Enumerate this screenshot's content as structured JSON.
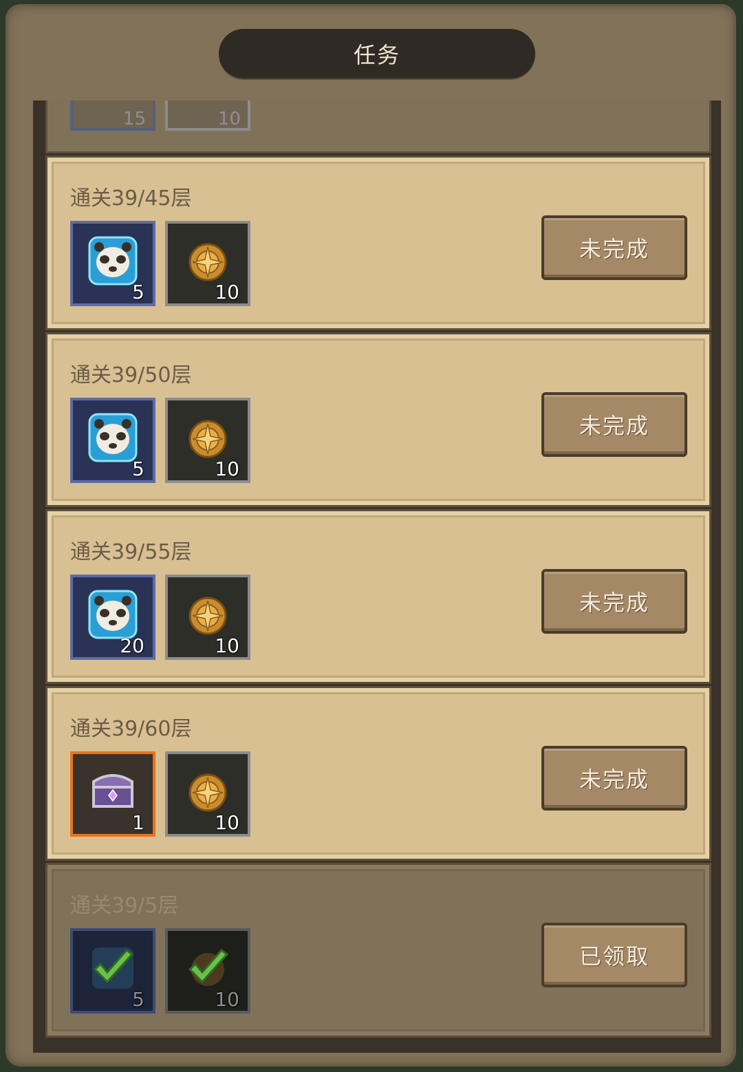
{
  "title": "任务",
  "partial_row": {
    "counts": [
      "15",
      "10"
    ]
  },
  "quests": [
    {
      "label": "通关39/45层",
      "status": "未完成",
      "rewards": [
        {
          "icon": "panda-head-icon",
          "frame": "blue",
          "count": "5"
        },
        {
          "icon": "gold-medal-icon",
          "frame": "gray",
          "count": "10"
        }
      ]
    },
    {
      "label": "通关39/50层",
      "status": "未完成",
      "rewards": [
        {
          "icon": "panda-head-icon",
          "frame": "blue",
          "count": "5"
        },
        {
          "icon": "gold-medal-icon",
          "frame": "gray",
          "count": "10"
        }
      ]
    },
    {
      "label": "通关39/55层",
      "status": "未完成",
      "rewards": [
        {
          "icon": "panda-head-icon",
          "frame": "blue",
          "count": "20"
        },
        {
          "icon": "gold-medal-icon",
          "frame": "gray",
          "count": "10"
        }
      ]
    },
    {
      "label": "通关39/60层",
      "status": "未完成",
      "rewards": [
        {
          "icon": "purple-chest-icon",
          "frame": "orange",
          "count": "1"
        },
        {
          "icon": "gold-medal-icon",
          "frame": "gray",
          "count": "10"
        }
      ]
    },
    {
      "label": "通关39/5层",
      "status": "已领取",
      "rewards": [
        {
          "icon": "checkmark-icon",
          "frame": "blue",
          "count": "5"
        },
        {
          "icon": "checkmark-icon",
          "frame": "gray",
          "count": "10"
        }
      ]
    }
  ]
}
